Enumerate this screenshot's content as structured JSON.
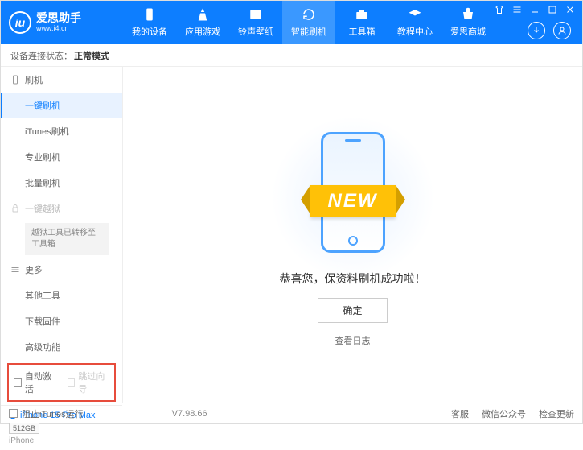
{
  "header": {
    "logo_title": "爱思助手",
    "logo_url": "www.i4.cn",
    "nav": [
      {
        "label": "我的设备"
      },
      {
        "label": "应用游戏"
      },
      {
        "label": "铃声壁纸"
      },
      {
        "label": "智能刷机"
      },
      {
        "label": "工具箱"
      },
      {
        "label": "教程中心"
      },
      {
        "label": "爱思商城"
      }
    ]
  },
  "status": {
    "label": "设备连接状态：",
    "mode": "正常模式"
  },
  "sidebar": {
    "flash_section": "刷机",
    "items": {
      "one_click": "一键刷机",
      "itunes": "iTunes刷机",
      "pro": "专业刷机",
      "batch": "批量刷机"
    },
    "jailbreak_section": "一键越狱",
    "jailbreak_notice": "越狱工具已转移至工具箱",
    "more_section": "更多",
    "more": {
      "other_tools": "其他工具",
      "download_fw": "下载固件",
      "advanced": "高级功能"
    },
    "auto_activate": "自动激活",
    "skip_wizard": "跳过向导"
  },
  "device": {
    "name": "iPhone 15 Pro Max",
    "storage": "512GB",
    "type": "iPhone"
  },
  "main": {
    "new_badge": "NEW",
    "success_text": "恭喜您，保资料刷机成功啦！",
    "ok_button": "确定",
    "view_log": "查看日志"
  },
  "footer": {
    "block_itunes": "阻止iTunes运行",
    "version": "V7.98.66",
    "support": "客服",
    "wechat": "微信公众号",
    "check_update": "检查更新"
  }
}
